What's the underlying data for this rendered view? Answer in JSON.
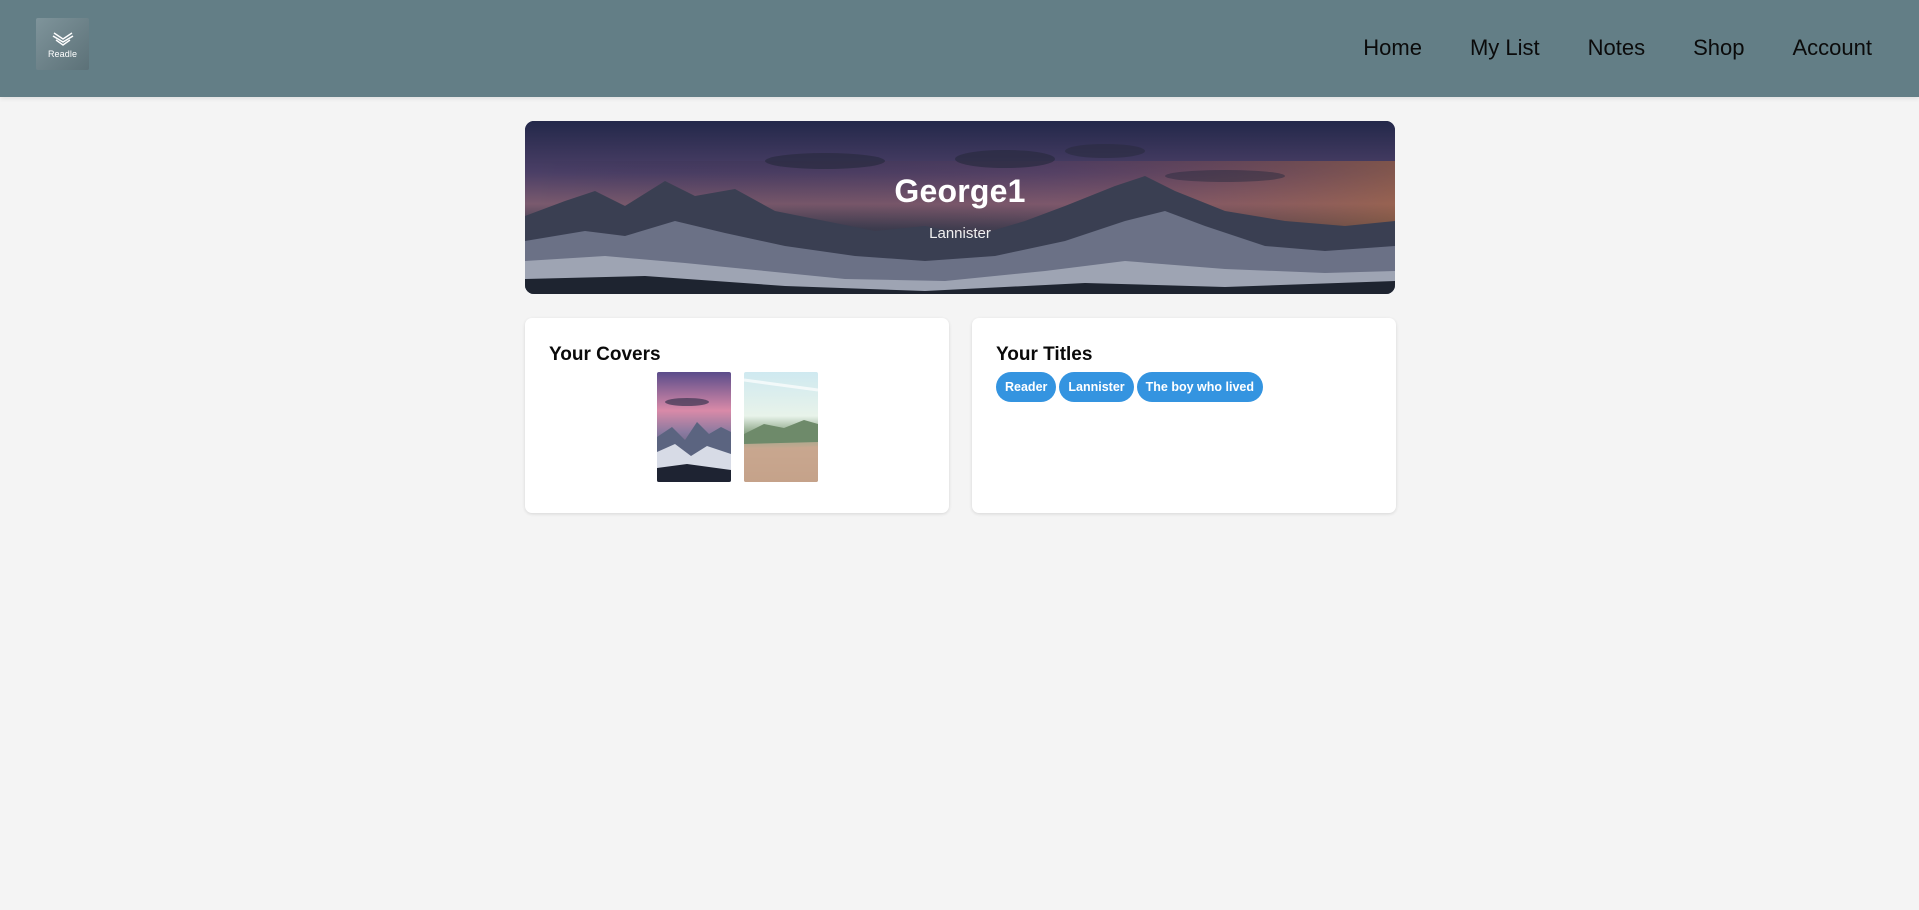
{
  "header": {
    "logo_text": "Readle",
    "nav": [
      "Home",
      "My List",
      "Notes",
      "Shop",
      "Account"
    ]
  },
  "profile": {
    "name": "George1",
    "subtitle": "Lannister"
  },
  "covers_card": {
    "title": "Your Covers"
  },
  "titles_card": {
    "title": "Your Titles",
    "badges": [
      "Reader",
      "Lannister",
      "The boy who lived"
    ]
  },
  "colors": {
    "header_bg": "#637e86",
    "page_bg": "#f4f4f4",
    "badge_bg": "#3494e0"
  }
}
